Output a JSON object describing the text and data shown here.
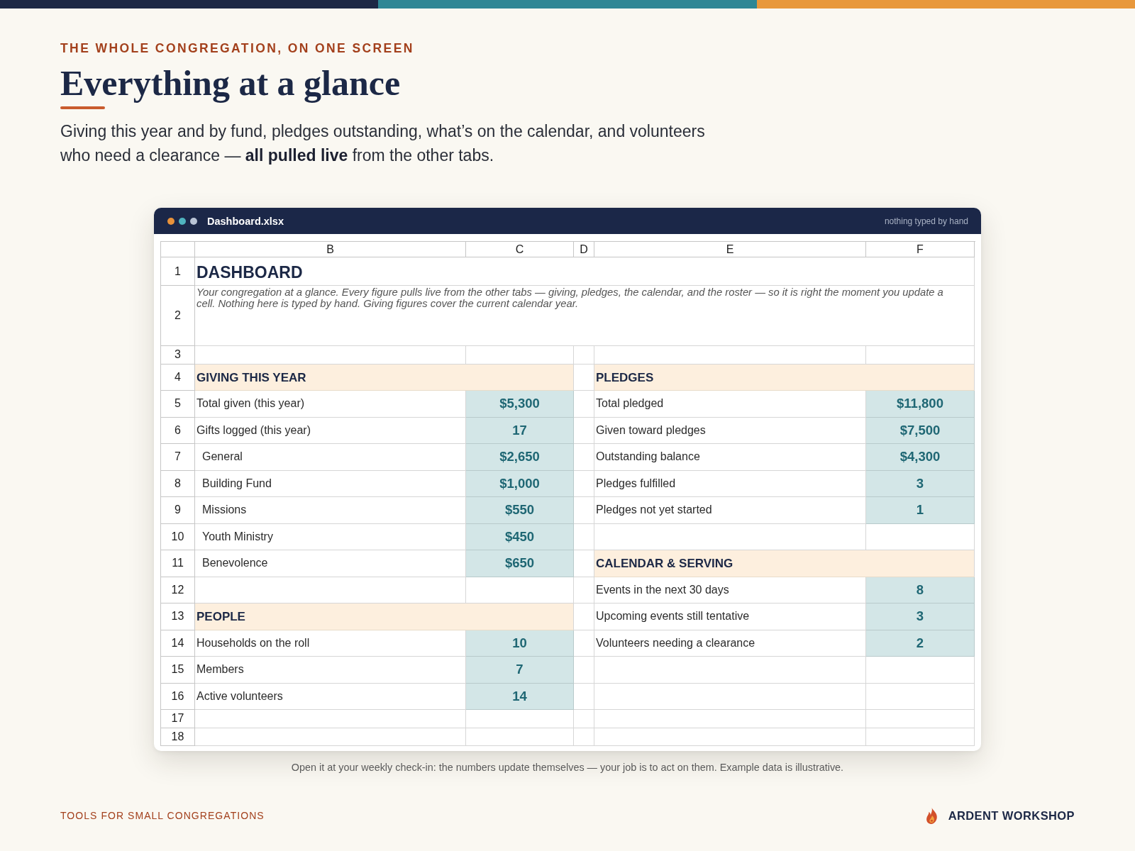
{
  "eyebrow": "THE WHOLE CONGREGATION, ON ONE SCREEN",
  "title": "Everything at a glance",
  "intro": "Giving this year and by fund, pledges outstanding, what’s on the calendar, and volunteers who need a clearance — **all pulled live** from the other tabs.",
  "window": {
    "title": "Dashboard.xlsx",
    "note": "nothing typed by hand",
    "sheet": {
      "columns": [
        "B",
        "C",
        "D",
        "E",
        "F"
      ],
      "rows": [
        {
          "number": "1",
          "kind": "title",
          "text": "DASHBOARD"
        },
        {
          "number": "2",
          "kind": "note",
          "text": "Your congregation at a glance. Every figure pulls live from the other tabs — giving, pledges, the calendar, and the roster — so it is right the moment you update a cell. Nothing here is typed by hand. Giving figures cover the current calendar year."
        },
        {
          "number": "3",
          "kind": "grid"
        },
        {
          "number": "4",
          "kind": "grid",
          "left": {
            "kind": "section",
            "label": "GIVING THIS YEAR"
          },
          "right": {
            "kind": "section",
            "label": "PLEDGES"
          }
        },
        {
          "number": "5",
          "kind": "grid",
          "left": {
            "kind": "metric",
            "label": "Total given (this year)",
            "value": "$5,300",
            "indented": false
          },
          "right": {
            "kind": "metric",
            "label": "Total pledged",
            "value": "$11,800",
            "indented": false
          }
        },
        {
          "number": "6",
          "kind": "grid",
          "left": {
            "kind": "metric",
            "label": "Gifts logged (this year)",
            "value": "17",
            "indented": false
          },
          "right": {
            "kind": "metric",
            "label": "Given toward pledges",
            "value": "$7,500",
            "indented": false
          }
        },
        {
          "number": "7",
          "kind": "grid",
          "left": {
            "kind": "metric",
            "label": "General",
            "value": "$2,650",
            "indented": true
          },
          "right": {
            "kind": "metric",
            "label": "Outstanding balance",
            "value": "$4,300",
            "indented": false
          }
        },
        {
          "number": "8",
          "kind": "grid",
          "left": {
            "kind": "metric",
            "label": "Building Fund",
            "value": "$1,000",
            "indented": true
          },
          "right": {
            "kind": "metric",
            "label": "Pledges fulfilled",
            "value": "3",
            "indented": false
          }
        },
        {
          "number": "9",
          "kind": "grid",
          "left": {
            "kind": "metric",
            "label": "Missions",
            "value": "$550",
            "indented": true
          },
          "right": {
            "kind": "metric",
            "label": "Pledges not yet started",
            "value": "1",
            "indented": false
          }
        },
        {
          "number": "10",
          "kind": "grid",
          "left": {
            "kind": "metric",
            "label": "Youth Ministry",
            "value": "$450",
            "indented": true
          }
        },
        {
          "number": "11",
          "kind": "grid",
          "left": {
            "kind": "metric",
            "label": "Benevolence",
            "value": "$650",
            "indented": true
          },
          "right": {
            "kind": "section",
            "label": "CALENDAR & SERVING"
          }
        },
        {
          "number": "12",
          "kind": "grid",
          "right": {
            "kind": "metric",
            "label": "Events in the next 30 days",
            "value": "8",
            "indented": false
          }
        },
        {
          "number": "13",
          "kind": "grid",
          "left": {
            "kind": "section",
            "label": "PEOPLE"
          },
          "right": {
            "kind": "metric",
            "label": "Upcoming events still tentative",
            "value": "3",
            "indented": false
          }
        },
        {
          "number": "14",
          "kind": "grid",
          "left": {
            "kind": "metric",
            "label": "Households on the roll",
            "value": "10",
            "indented": false
          },
          "right": {
            "kind": "metric",
            "label": "Volunteers needing a clearance",
            "value": "2",
            "indented": false
          }
        },
        {
          "number": "15",
          "kind": "grid",
          "left": {
            "kind": "metric",
            "label": "Members",
            "value": "7",
            "indented": false
          }
        },
        {
          "number": "16",
          "kind": "grid",
          "left": {
            "kind": "metric",
            "label": "Active volunteers",
            "value": "14",
            "indented": false
          }
        },
        {
          "number": "17",
          "kind": "grid"
        },
        {
          "number": "18",
          "kind": "grid"
        }
      ]
    }
  },
  "caption": "Open it at your weekly check-in: the numbers update themselves — your job is to act on them. Example data is illustrative.",
  "footer": {
    "tagline": "TOOLS FOR SMALL CONGREGATIONS",
    "brand": "ARDENT WORKSHOP"
  }
}
